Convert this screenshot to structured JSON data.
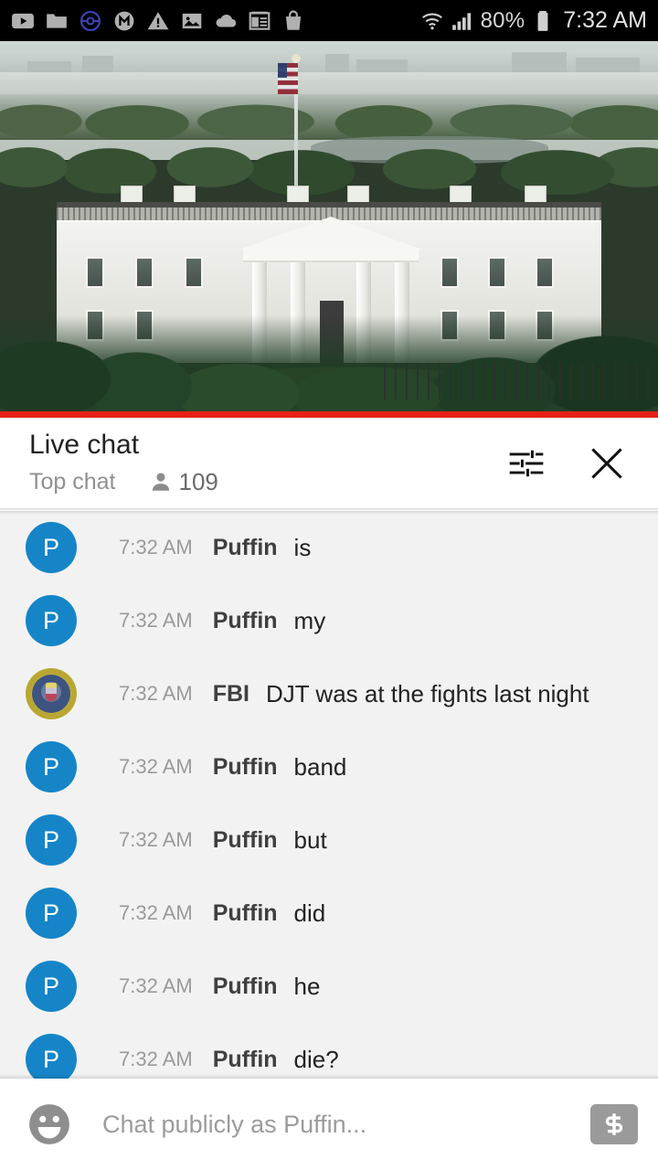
{
  "status_bar": {
    "icons": [
      "youtube-icon",
      "folder-icon",
      "pokeball-icon",
      "m-circle-icon",
      "warning-triangle-icon",
      "image-icon",
      "cloud-icon",
      "calendar-icon",
      "shopping-bag-icon"
    ],
    "wifi_icon": "wifi-icon",
    "signal_icon": "signal-bars-icon",
    "battery_percent": "80%",
    "battery_icon": "battery-icon",
    "time": "7:32 AM"
  },
  "video": {
    "scene": "White House north facade live stream",
    "progress_color": "#e62117",
    "progress_percent": 100
  },
  "chat_header": {
    "title": "Live chat",
    "subtitle": "Top chat",
    "viewer_icon": "person-icon",
    "viewer_count": "109",
    "settings_icon": "tune-sliders-icon",
    "close_icon": "close-x-icon"
  },
  "messages": [
    {
      "avatar_type": "letter",
      "avatar_letter": "P",
      "avatar_color": "#1585c8",
      "time": "7:32 AM",
      "author": "Puffin",
      "text": "is"
    },
    {
      "avatar_type": "letter",
      "avatar_letter": "P",
      "avatar_color": "#1585c8",
      "time": "7:32 AM",
      "author": "Puffin",
      "text": "my"
    },
    {
      "avatar_type": "seal",
      "avatar_letter": "",
      "avatar_color": "#c9b63e",
      "time": "7:32 AM",
      "author": "FBI",
      "text": "DJT was at the fights last night"
    },
    {
      "avatar_type": "letter",
      "avatar_letter": "P",
      "avatar_color": "#1585c8",
      "time": "7:32 AM",
      "author": "Puffin",
      "text": "band"
    },
    {
      "avatar_type": "letter",
      "avatar_letter": "P",
      "avatar_color": "#1585c8",
      "time": "7:32 AM",
      "author": "Puffin",
      "text": "but"
    },
    {
      "avatar_type": "letter",
      "avatar_letter": "P",
      "avatar_color": "#1585c8",
      "time": "7:32 AM",
      "author": "Puffin",
      "text": "did"
    },
    {
      "avatar_type": "letter",
      "avatar_letter": "P",
      "avatar_color": "#1585c8",
      "time": "7:32 AM",
      "author": "Puffin",
      "text": "he"
    },
    {
      "avatar_type": "letter",
      "avatar_letter": "P",
      "avatar_color": "#1585c8",
      "time": "7:32 AM",
      "author": "Puffin",
      "text": "die?"
    }
  ],
  "input_bar": {
    "emoji_icon": "emoji-smiley-icon",
    "placeholder": "Chat publicly as Puffin...",
    "value": "",
    "superchat_icon": "dollar-sign-icon"
  }
}
